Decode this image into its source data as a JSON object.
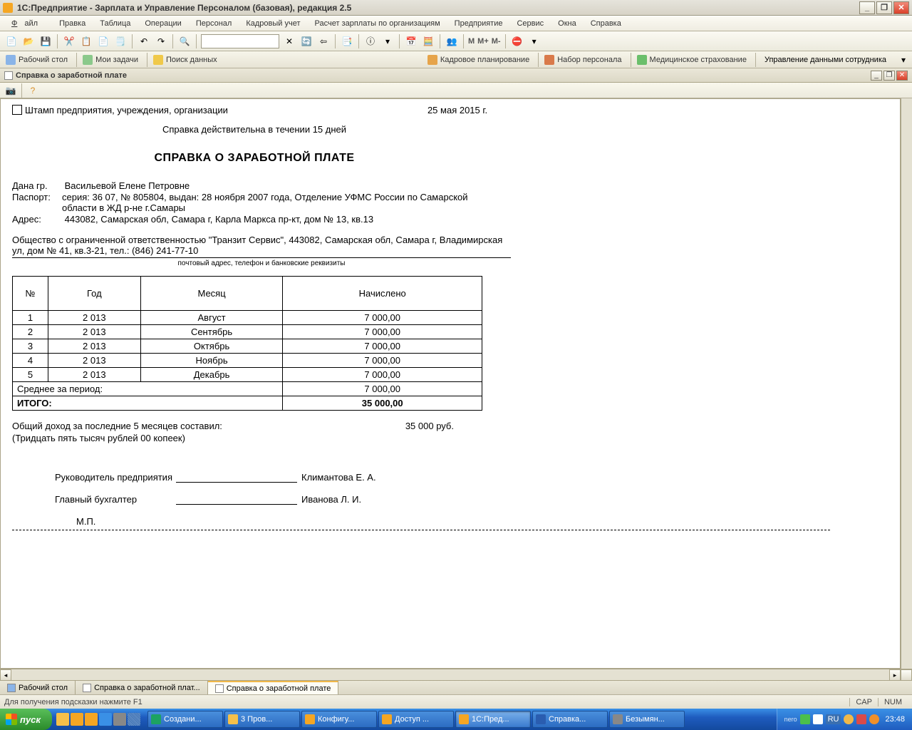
{
  "titlebar": {
    "title": "1С:Предприятие - Зарплата и Управление Персоналом (базовая), редакция 2.5"
  },
  "menu": [
    "Файл",
    "Правка",
    "Таблица",
    "Операции",
    "Персонал",
    "Кадровый учет",
    "Расчет зарплаты по организациям",
    "Предприятие",
    "Сервис",
    "Окна",
    "Справка"
  ],
  "toolbar": {
    "m1": "M",
    "m2": "M+",
    "m3": "M-"
  },
  "toolbar2": {
    "desktop": "Рабочий стол",
    "mytasks": "Мои задачи",
    "search": "Поиск данных",
    "hrplan": "Кадровое планирование",
    "recruit": "Набор персонала",
    "medins": "Медицинское страхование",
    "empdata": "Управление данными сотрудника"
  },
  "doctab": {
    "title": "Справка о заработной плате"
  },
  "doc": {
    "stamp": "Штамп предприятия, учреждения, организации",
    "date": "25 мая 2015 г.",
    "validity": "Справка действительна в течении 15 дней",
    "title": "СПРАВКА О ЗАРАБОТНОЙ ПЛАТЕ",
    "given_label": "Дана гр.",
    "given_name": "Васильевой Елене Петровне",
    "passport_label": "Паспорт:",
    "passport": "серия: 36 07, № 805804, выдан: 28 ноября 2007 года, Отделение УФМС России по Самарской области в ЖД р-не г.Самары",
    "address_label": "Адрес:",
    "address": "443082, Самарская обл, Самара г, Карла Маркса пр-кт, дом № 13, кв.13",
    "org": "Общество с ограниченной ответственностью  \"Транзит Сервис\", 443082, Самарская обл, Самара г, Владимирская ул, дом № 41, кв.3-21, тел.: (846) 241-77-10",
    "org_caption": "почтовый адрес, телефон и банковские реквизиты",
    "table": {
      "headers": [
        "№",
        "Год",
        "Месяц",
        "Начислено"
      ],
      "rows": [
        [
          "1",
          "2 013",
          "Август",
          "7 000,00"
        ],
        [
          "2",
          "2 013",
          "Сентябрь",
          "7 000,00"
        ],
        [
          "3",
          "2 013",
          "Октябрь",
          "7 000,00"
        ],
        [
          "4",
          "2 013",
          "Ноябрь",
          "7 000,00"
        ],
        [
          "5",
          "2 013",
          "Декабрь",
          "7 000,00"
        ]
      ],
      "avg_label": "Среднее за период:",
      "avg_value": "7 000,00",
      "total_label": "ИТОГО:",
      "total_value": "35 000,00"
    },
    "total_text_label": "Общий доход  за последние 5 месяцев  составил:",
    "total_text_value": "35 000  руб.",
    "total_words": "(Тридцать пять тысяч рублей 00 копеек)",
    "sign1_role": "Руководитель предприятия",
    "sign1_name": "Климантова Е. А.",
    "sign2_role": "Главный бухгалтер",
    "sign2_name": "Иванова Л. И.",
    "mp": "М.П."
  },
  "tabs": [
    {
      "label": "Рабочий стол",
      "active": false
    },
    {
      "label": "Справка о заработной плат...",
      "active": false
    },
    {
      "label": "Справка о заработной плате",
      "active": true
    }
  ],
  "status": {
    "hint": "Для получения подсказки нажмите F1",
    "cap": "CAP",
    "num": "NUM"
  },
  "taskbar": {
    "start": "пуск",
    "tasks": [
      {
        "label": "Создани...",
        "color": "#fff",
        "icon": "#1da362"
      },
      {
        "label": "3 Пров...",
        "color": "#fff",
        "icon": "#f5c04a"
      },
      {
        "label": "Конфигу...",
        "color": "#fff",
        "icon": "#f5a623"
      },
      {
        "label": "Доступ ...",
        "color": "#fff",
        "icon": "#f5a623"
      },
      {
        "label": "1С:Пред...",
        "color": "#fff",
        "icon": "#f5a623",
        "active": true
      },
      {
        "label": "Справка...",
        "color": "#fff",
        "icon": "#2a5db0"
      },
      {
        "label": "Безымян...",
        "color": "#fff",
        "icon": "#888"
      }
    ],
    "lang": "RU",
    "clock": "23:48"
  }
}
